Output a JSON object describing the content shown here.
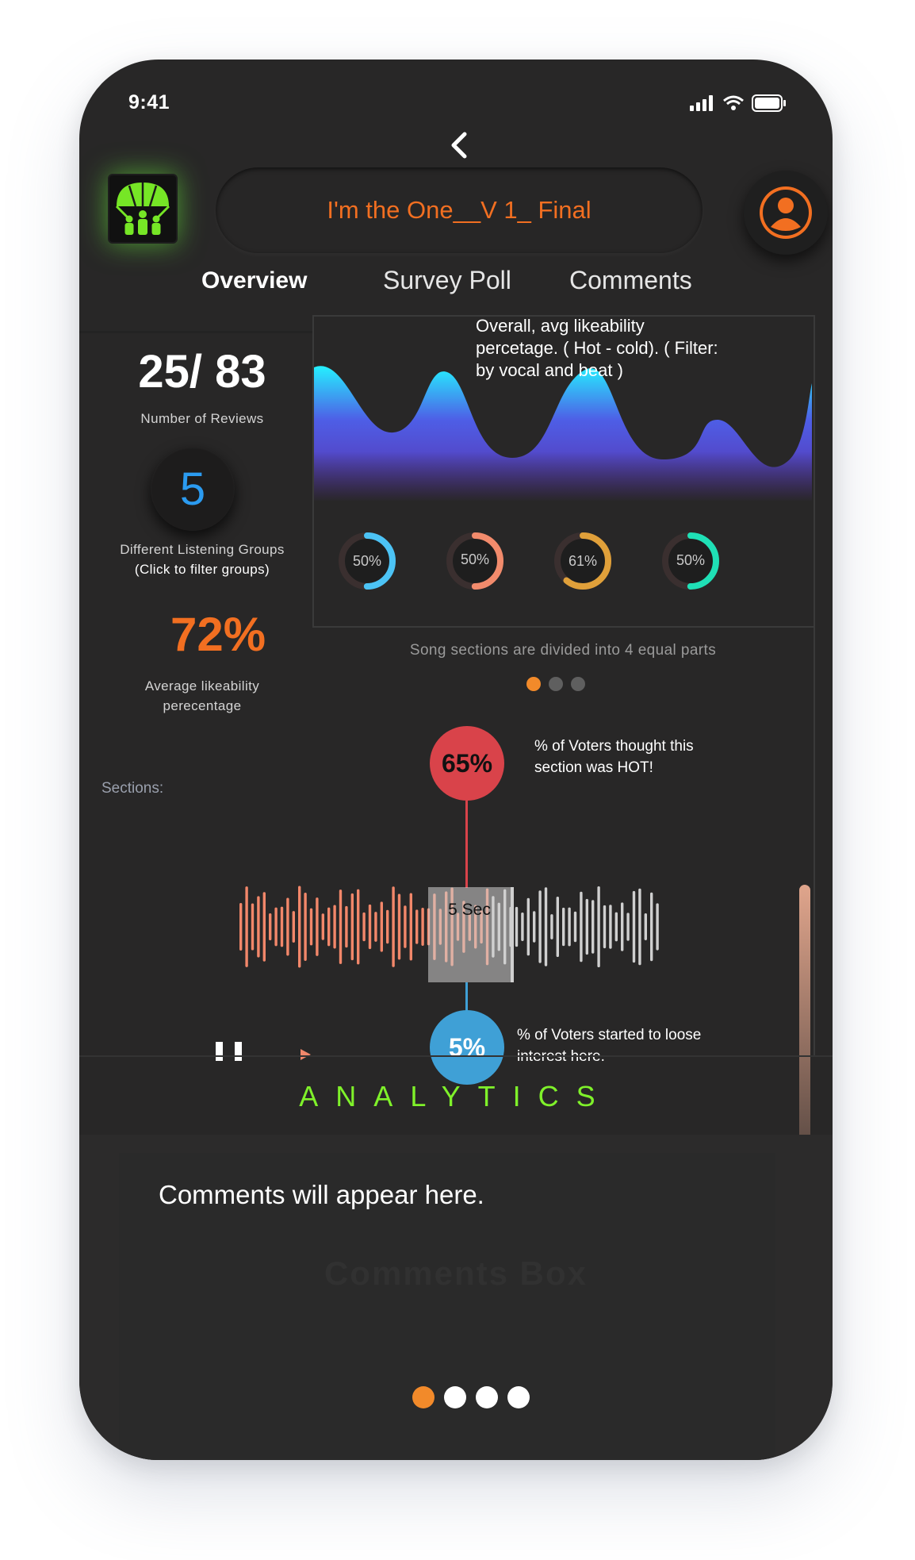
{
  "status": {
    "time": "9:41"
  },
  "header": {
    "title": "I'm the One__V 1_ Final"
  },
  "tabs": [
    {
      "label": "Overview",
      "active": true
    },
    {
      "label": "Survey Poll",
      "active": false
    },
    {
      "label": "Comments",
      "active": false
    }
  ],
  "stats": {
    "reviews_value": "25/ 83",
    "reviews_label": "Number of Reviews",
    "groups_value": "5",
    "groups_label_line1": "Different Listening Groups",
    "groups_label_line2": "(Click to filter groups)",
    "likeability_value": "72%",
    "likeability_label_line1": "Average likeability",
    "likeability_label_line2": "perecentage"
  },
  "chart": {
    "title": "Overall, avg  likeability percetage. ( Hot - cold). ( Filter: by vocal and beat )",
    "caption": "Song sections are divided into 4 equal parts",
    "gradient_colors": [
      "#25f0ff",
      "#4e5ee6",
      "#5a2fa8"
    ],
    "donuts": [
      {
        "label": "50%",
        "value": 50,
        "color": "#4cc3f5"
      },
      {
        "label": "50%",
        "value": 50,
        "color": "#f28b6c"
      },
      {
        "label": "61%",
        "value": 61,
        "color": "#e0a03a"
      },
      {
        "label": "50%",
        "value": 50,
        "color": "#1fe0b6"
      }
    ],
    "pager": {
      "count": 3,
      "active_index": 0
    }
  },
  "sections": {
    "label": "Sections:",
    "marker_label": "5 Sec",
    "hot_pct": "65%",
    "hot_caption_line1": "% of Voters thought this",
    "hot_caption_line2": "section was HOT!",
    "loose_pct": "5%",
    "loose_caption_line1": "% of Voters started to loose",
    "loose_caption_line2": "interest here."
  },
  "analytics_label": "ANALYTICS",
  "comments": {
    "placeholder": "Comments will appear here.",
    "watermark": "Comments Box",
    "pager": {
      "count": 4,
      "active_index": 0
    }
  },
  "colors": {
    "accent_orange": "#f26f21",
    "analytics_green": "#7ff12a",
    "hot_red": "#d9434a",
    "cold_blue": "#3fa0d6",
    "wave_played": "#f2876a",
    "wave_unplayed": "#cfcfcf"
  }
}
